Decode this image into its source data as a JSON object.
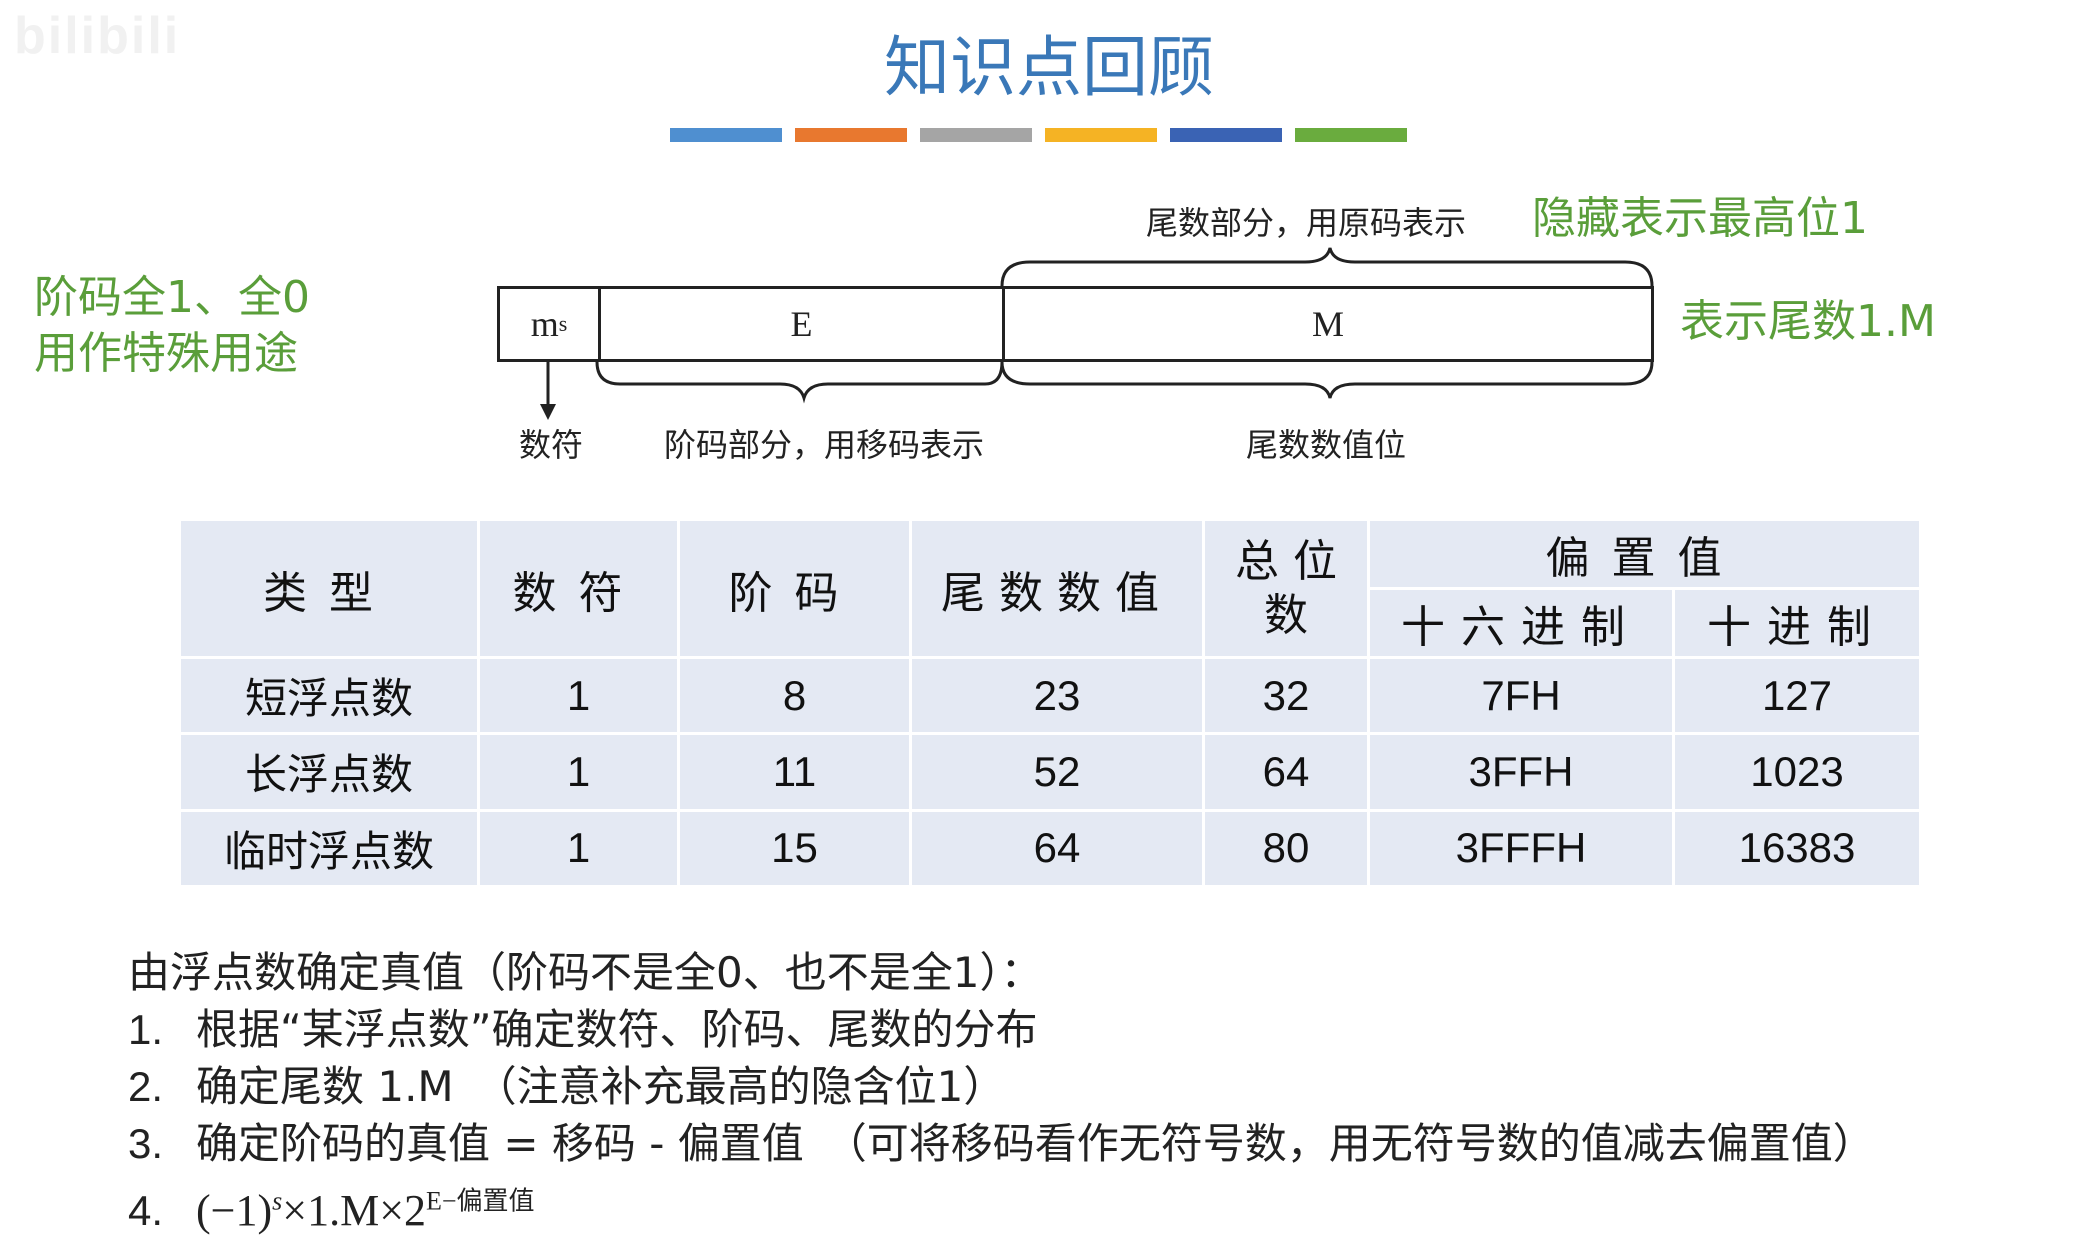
{
  "watermark": "bilibili",
  "title": "知识点回顾",
  "color_bar": [
    "#4f8fd0",
    "#e8782f",
    "#a5a5a5",
    "#f5b324",
    "#3a63b4",
    "#6aac3e"
  ],
  "left_note": [
    "阶码全1、全0",
    "用作特殊用途"
  ],
  "right_note": "表示尾数1.M",
  "top_label": "尾数部分，用原码表示",
  "top_note": "隐藏表示最高位1",
  "format_fields": [
    "m",
    "E",
    "M"
  ],
  "ms_subscript": "s",
  "bottom_labels": {
    "sign": "数符",
    "exponent": "阶码部分，用移码表示",
    "mantissa": "尾数数值位"
  },
  "table": {
    "headers": [
      "类型",
      "数符",
      "阶码",
      "尾数数值",
      "总位数",
      "偏置值"
    ],
    "total_line1": "总 位",
    "total_line2": "数",
    "bias_sub_headers": [
      "十六进制",
      "十进制"
    ],
    "rows": [
      [
        "短浮点数",
        "1",
        "8",
        "23",
        "32",
        "7FH",
        "127"
      ],
      [
        "长浮点数",
        "1",
        "11",
        "52",
        "64",
        "3FFH",
        "1023"
      ],
      [
        "临时浮点数",
        "1",
        "15",
        "64",
        "80",
        "3FFFH",
        "16383"
      ]
    ]
  },
  "steps_intro": "由浮点数确定真值（阶码不是全0、也不是全1）：",
  "steps": [
    {
      "num": "1.",
      "text": "根据“某浮点数”确定数符、阶码、尾数的分布"
    },
    {
      "num": "2.",
      "text": "确定尾数 1.M　（注意补充最高的隐含位1）"
    },
    {
      "num": "3.",
      "text": "确定阶码的真值 = 移码 - 偏置值　（可将移码看作无符号数，用无符号数的值减去偏置值）"
    },
    {
      "num": "4.",
      "text": ""
    }
  ],
  "formula": {
    "base": "(−1)",
    "sign_exp": "s",
    "middle": "×1.M×2",
    "exp": "E−偏置值"
  }
}
